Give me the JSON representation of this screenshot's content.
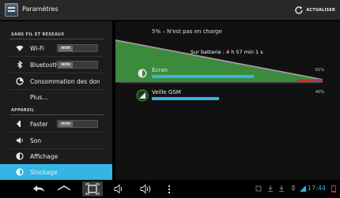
{
  "header": {
    "app_title": "Paramètres",
    "refresh_label": "ACTUALISER"
  },
  "sidebar": {
    "section_network": "SANS FIL ET RÉSEAUX",
    "section_device": "APPAREIL",
    "items": [
      {
        "label": "Wi-Fi",
        "icon": "wifi-icon",
        "toggle": "NON"
      },
      {
        "label": "Bluetooth",
        "icon": "bluetooth-icon",
        "toggle": "NON"
      },
      {
        "label": "Consommation des données",
        "icon": "data-usage-icon"
      },
      {
        "label": "Plus…",
        "icon": ""
      },
      {
        "label": "Faster",
        "icon": "speed-icon",
        "toggle": "NON"
      },
      {
        "label": "Son",
        "icon": "speaker-icon"
      },
      {
        "label": "Affichage",
        "icon": "brightness-icon"
      },
      {
        "label": "Stockage",
        "icon": "storage-icon"
      }
    ]
  },
  "battery": {
    "status": "5% – N'est pas en charge",
    "graph_label": "Sur batterie : 4 h 57 min 1 s",
    "usages": [
      {
        "name": "Écran",
        "percent_label": "61%",
        "percent": 61,
        "icon": "brightness-icon"
      },
      {
        "name": "Veille GSM",
        "percent_label": "40%",
        "percent": 40,
        "icon": "signal-icon"
      }
    ]
  },
  "statusbar": {
    "time": "17:44"
  },
  "colors": {
    "accent": "#33b5e5",
    "graph_green": "#3c8a3c",
    "graph_red": "#c0302c"
  }
}
